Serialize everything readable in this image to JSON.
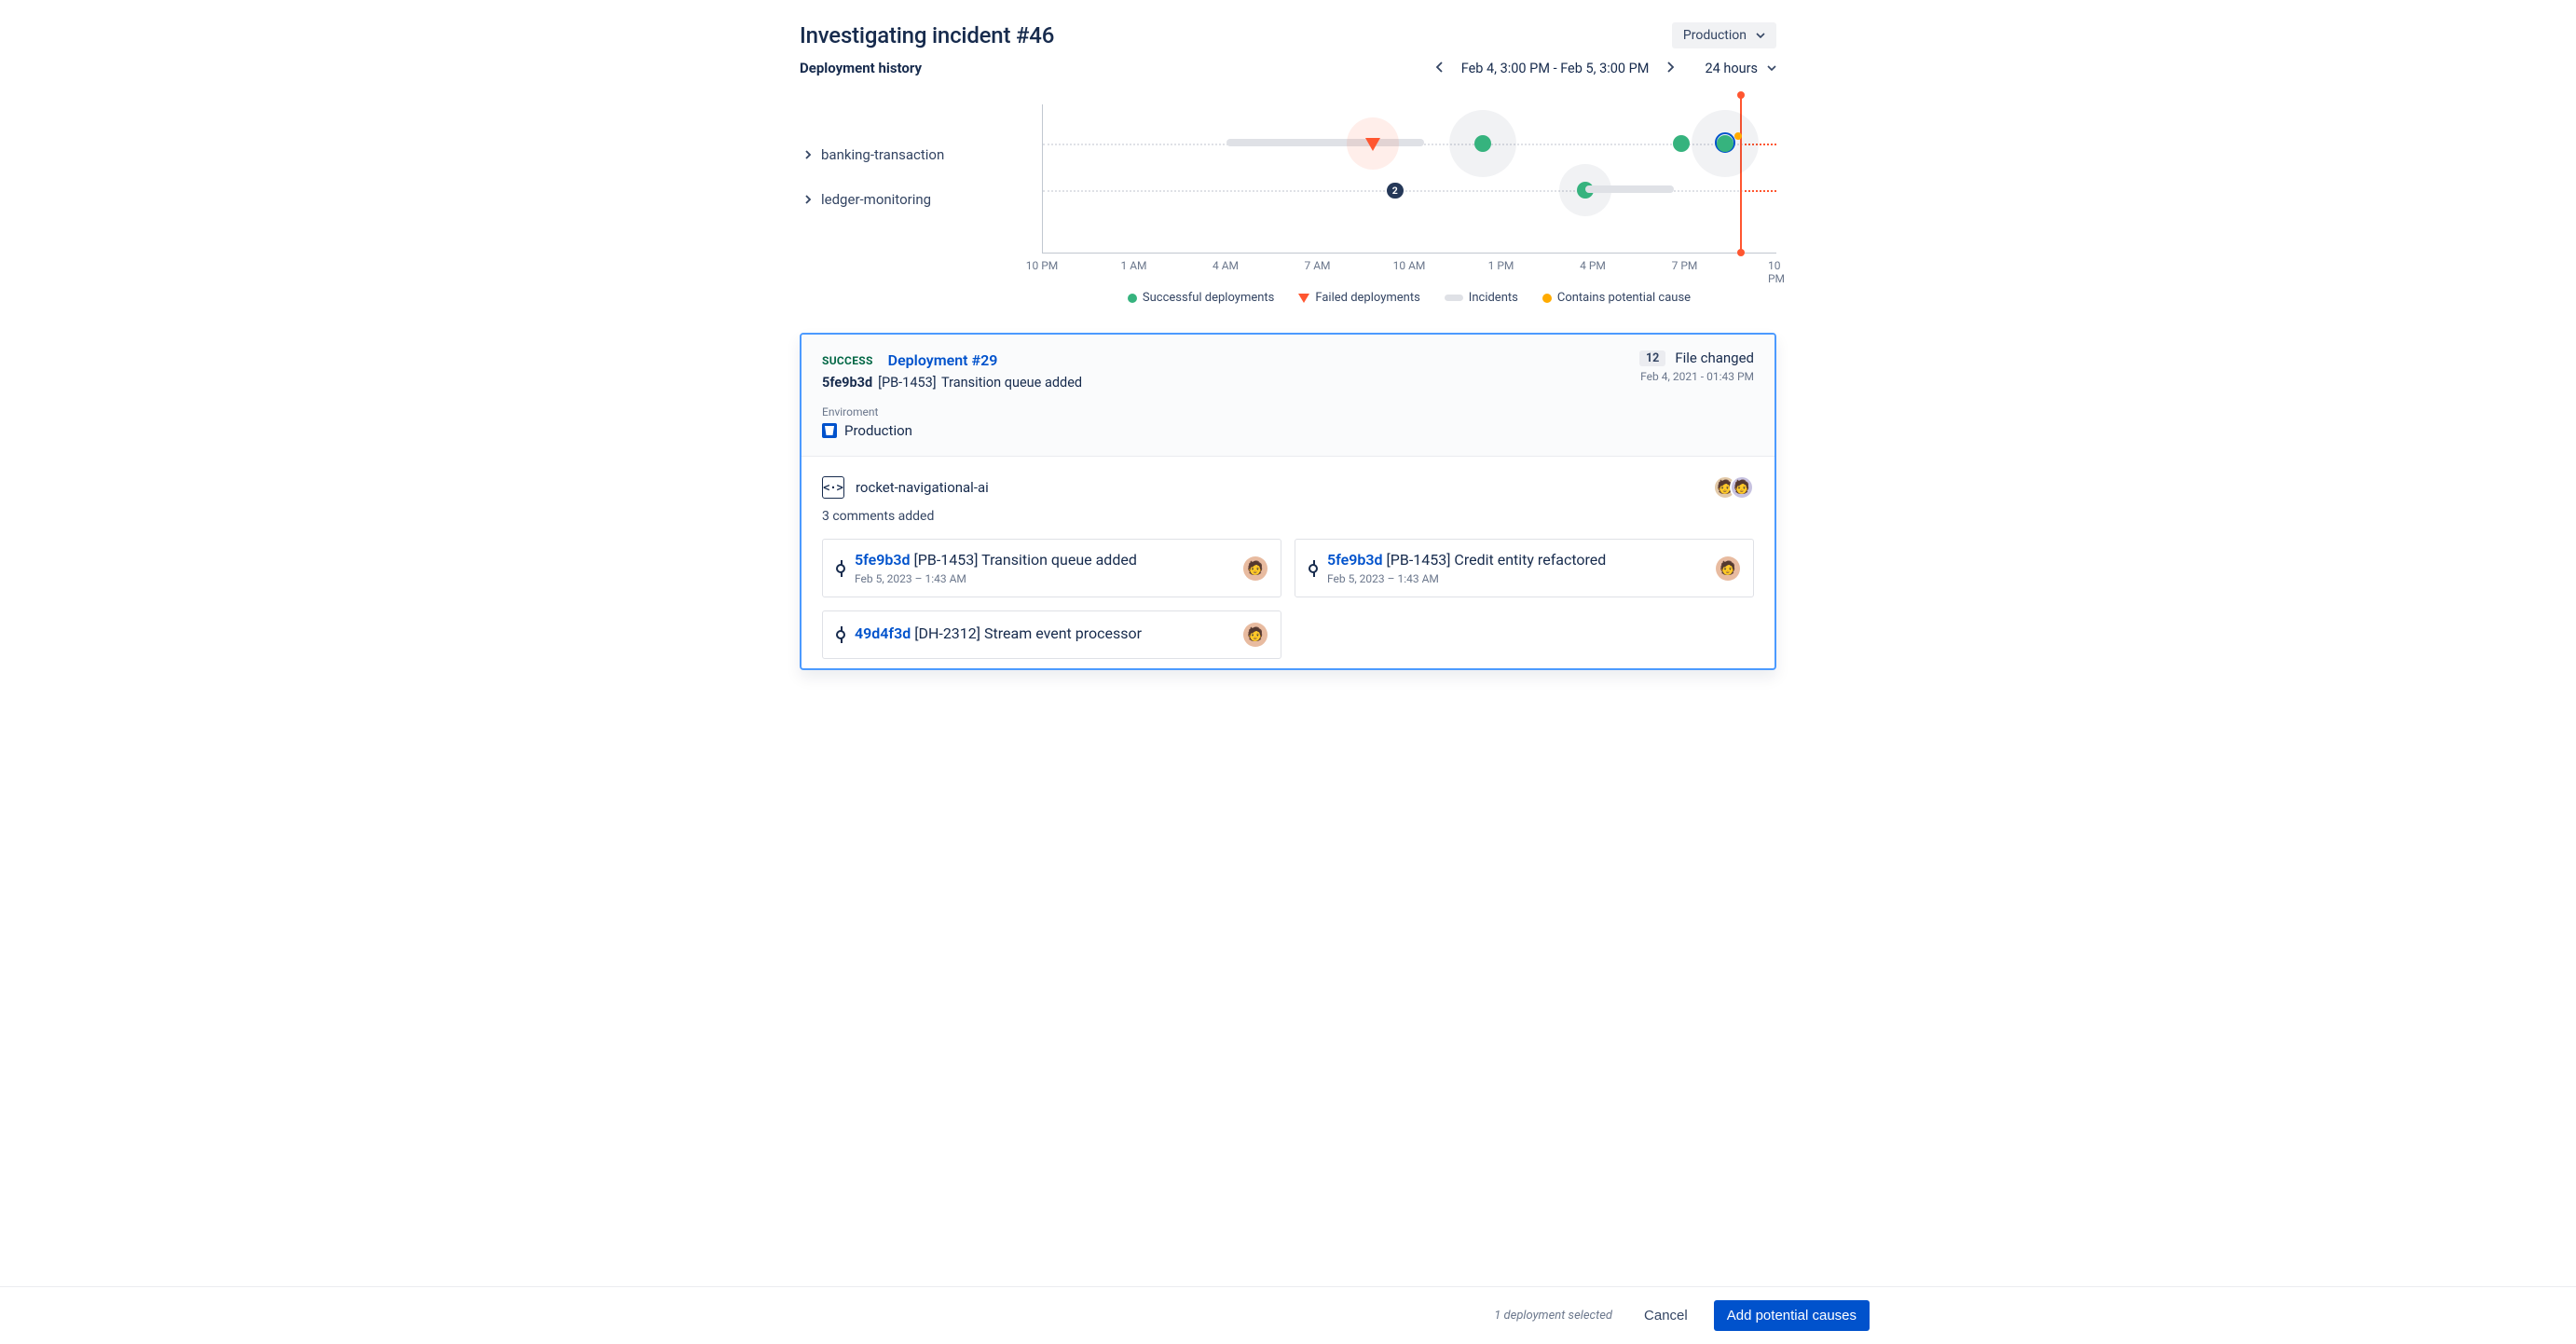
{
  "header": {
    "title": "Investigating incident #46",
    "env_select": "Production"
  },
  "subheader": {
    "label": "Deployment history",
    "range_text": "Feb 4, 3:00 PM - Feb 5, 3:00 PM",
    "span_select": "24 hours"
  },
  "timeline": {
    "ticks": [
      "10 PM",
      "1 AM",
      "4 AM",
      "7 AM",
      "10 AM",
      "1 PM",
      "4 PM",
      "7 PM",
      "10 PM"
    ],
    "lanes": [
      {
        "name": "banking-transaction"
      },
      {
        "name": "ledger-monitoring"
      }
    ],
    "legend": {
      "success": "Successful deployments",
      "failed": "Failed deployments",
      "incidents": "Incidents",
      "potential": "Contains potential cause"
    },
    "ledger_badge": "2"
  },
  "card": {
    "status": "SUCCESS",
    "title": "Deployment #29",
    "sha": "5fe9b3d",
    "ticket": "[PB-1453]",
    "msg": "Transition queue added",
    "env_label": "Enviroment",
    "env_value": "Production",
    "files_count": "12",
    "files_label": "File changed",
    "files_date": "Feb 4, 2021 - 01:43 PM",
    "repo": "rocket-navigational-ai",
    "comments": "3 comments added",
    "commits": [
      {
        "sha": "5fe9b3d",
        "ticket": "[PB-1453]",
        "msg": "Transition queue added",
        "dt": "Feb 5, 2023 – 1:43 AM"
      },
      {
        "sha": "5fe9b3d",
        "ticket": "[PB-1453]",
        "msg": "Credit entity refactored",
        "dt": "Feb 5, 2023 – 1:43 AM"
      },
      {
        "sha": "49d4f3d",
        "ticket": "[DH-2312]",
        "msg": "Stream event processor",
        "dt": ""
      }
    ]
  },
  "footer": {
    "sel_info": "1 deployment selected",
    "cancel": "Cancel",
    "primary": "Add potential causes"
  },
  "colors": {
    "green": "#36B37E",
    "red": "#FF5630",
    "amber": "#FFAB00",
    "blue": "#0052CC"
  },
  "chart_data": {
    "type": "timeline",
    "x_axis": {
      "start": "Feb 4, 10:00 PM",
      "end": "Feb 5, 10:00 PM",
      "ticks": [
        "10 PM",
        "1 AM",
        "4 AM",
        "7 AM",
        "10 AM",
        "1 PM",
        "4 PM",
        "7 PM",
        "10 PM"
      ]
    },
    "cursor_time_pct": 95,
    "series": [
      {
        "name": "banking-transaction",
        "events": [
          {
            "kind": "incident_bar",
            "start_pct": 25,
            "end_pct": 38
          },
          {
            "kind": "incident_bar",
            "start_pct": 37,
            "end_pct": 52
          },
          {
            "kind": "failed",
            "x_pct": 45,
            "halo": true
          },
          {
            "kind": "success",
            "x_pct": 60,
            "halo": "big"
          },
          {
            "kind": "success",
            "x_pct": 87
          },
          {
            "kind": "success_selected_potential",
            "x_pct": 93,
            "halo": "big"
          }
        ]
      },
      {
        "name": "ledger-monitoring",
        "events": [
          {
            "kind": "count_badge",
            "x_pct": 48,
            "value": 2
          },
          {
            "kind": "success",
            "x_pct": 74,
            "halo": true
          },
          {
            "kind": "incident_bar",
            "start_pct": 74,
            "end_pct": 86
          }
        ]
      }
    ]
  }
}
